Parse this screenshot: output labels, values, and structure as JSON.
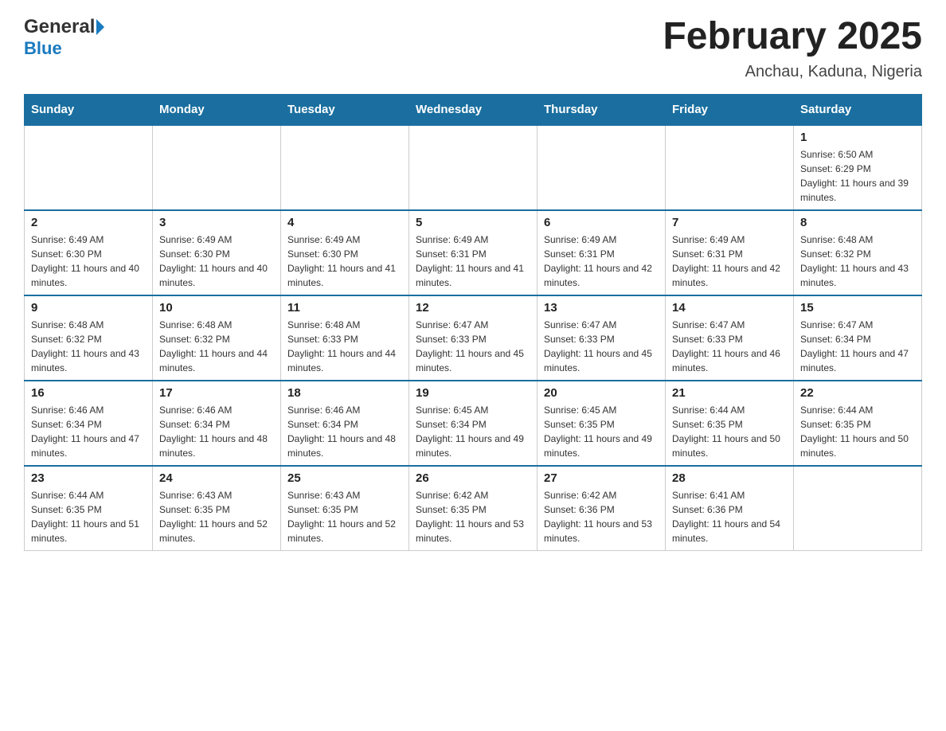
{
  "logo": {
    "general": "General",
    "blue": "Blue"
  },
  "title": "February 2025",
  "subtitle": "Anchau, Kaduna, Nigeria",
  "weekdays": [
    "Sunday",
    "Monday",
    "Tuesday",
    "Wednesday",
    "Thursday",
    "Friday",
    "Saturday"
  ],
  "weeks": [
    [
      {
        "day": "",
        "info": ""
      },
      {
        "day": "",
        "info": ""
      },
      {
        "day": "",
        "info": ""
      },
      {
        "day": "",
        "info": ""
      },
      {
        "day": "",
        "info": ""
      },
      {
        "day": "",
        "info": ""
      },
      {
        "day": "1",
        "info": "Sunrise: 6:50 AM\nSunset: 6:29 PM\nDaylight: 11 hours and 39 minutes."
      }
    ],
    [
      {
        "day": "2",
        "info": "Sunrise: 6:49 AM\nSunset: 6:30 PM\nDaylight: 11 hours and 40 minutes."
      },
      {
        "day": "3",
        "info": "Sunrise: 6:49 AM\nSunset: 6:30 PM\nDaylight: 11 hours and 40 minutes."
      },
      {
        "day": "4",
        "info": "Sunrise: 6:49 AM\nSunset: 6:30 PM\nDaylight: 11 hours and 41 minutes."
      },
      {
        "day": "5",
        "info": "Sunrise: 6:49 AM\nSunset: 6:31 PM\nDaylight: 11 hours and 41 minutes."
      },
      {
        "day": "6",
        "info": "Sunrise: 6:49 AM\nSunset: 6:31 PM\nDaylight: 11 hours and 42 minutes."
      },
      {
        "day": "7",
        "info": "Sunrise: 6:49 AM\nSunset: 6:31 PM\nDaylight: 11 hours and 42 minutes."
      },
      {
        "day": "8",
        "info": "Sunrise: 6:48 AM\nSunset: 6:32 PM\nDaylight: 11 hours and 43 minutes."
      }
    ],
    [
      {
        "day": "9",
        "info": "Sunrise: 6:48 AM\nSunset: 6:32 PM\nDaylight: 11 hours and 43 minutes."
      },
      {
        "day": "10",
        "info": "Sunrise: 6:48 AM\nSunset: 6:32 PM\nDaylight: 11 hours and 44 minutes."
      },
      {
        "day": "11",
        "info": "Sunrise: 6:48 AM\nSunset: 6:33 PM\nDaylight: 11 hours and 44 minutes."
      },
      {
        "day": "12",
        "info": "Sunrise: 6:47 AM\nSunset: 6:33 PM\nDaylight: 11 hours and 45 minutes."
      },
      {
        "day": "13",
        "info": "Sunrise: 6:47 AM\nSunset: 6:33 PM\nDaylight: 11 hours and 45 minutes."
      },
      {
        "day": "14",
        "info": "Sunrise: 6:47 AM\nSunset: 6:33 PM\nDaylight: 11 hours and 46 minutes."
      },
      {
        "day": "15",
        "info": "Sunrise: 6:47 AM\nSunset: 6:34 PM\nDaylight: 11 hours and 47 minutes."
      }
    ],
    [
      {
        "day": "16",
        "info": "Sunrise: 6:46 AM\nSunset: 6:34 PM\nDaylight: 11 hours and 47 minutes."
      },
      {
        "day": "17",
        "info": "Sunrise: 6:46 AM\nSunset: 6:34 PM\nDaylight: 11 hours and 48 minutes."
      },
      {
        "day": "18",
        "info": "Sunrise: 6:46 AM\nSunset: 6:34 PM\nDaylight: 11 hours and 48 minutes."
      },
      {
        "day": "19",
        "info": "Sunrise: 6:45 AM\nSunset: 6:34 PM\nDaylight: 11 hours and 49 minutes."
      },
      {
        "day": "20",
        "info": "Sunrise: 6:45 AM\nSunset: 6:35 PM\nDaylight: 11 hours and 49 minutes."
      },
      {
        "day": "21",
        "info": "Sunrise: 6:44 AM\nSunset: 6:35 PM\nDaylight: 11 hours and 50 minutes."
      },
      {
        "day": "22",
        "info": "Sunrise: 6:44 AM\nSunset: 6:35 PM\nDaylight: 11 hours and 50 minutes."
      }
    ],
    [
      {
        "day": "23",
        "info": "Sunrise: 6:44 AM\nSunset: 6:35 PM\nDaylight: 11 hours and 51 minutes."
      },
      {
        "day": "24",
        "info": "Sunrise: 6:43 AM\nSunset: 6:35 PM\nDaylight: 11 hours and 52 minutes."
      },
      {
        "day": "25",
        "info": "Sunrise: 6:43 AM\nSunset: 6:35 PM\nDaylight: 11 hours and 52 minutes."
      },
      {
        "day": "26",
        "info": "Sunrise: 6:42 AM\nSunset: 6:35 PM\nDaylight: 11 hours and 53 minutes."
      },
      {
        "day": "27",
        "info": "Sunrise: 6:42 AM\nSunset: 6:36 PM\nDaylight: 11 hours and 53 minutes."
      },
      {
        "day": "28",
        "info": "Sunrise: 6:41 AM\nSunset: 6:36 PM\nDaylight: 11 hours and 54 minutes."
      },
      {
        "day": "",
        "info": ""
      }
    ]
  ]
}
